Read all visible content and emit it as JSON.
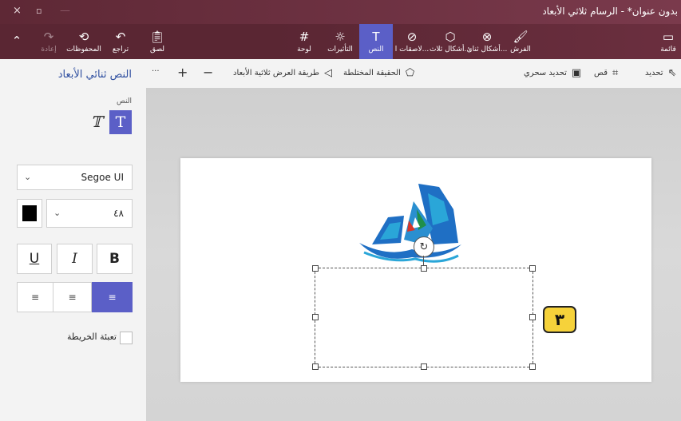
{
  "titlebar": {
    "title": "بدون عنوان* - الرسام ثلاثي الأبعاد",
    "close_glyph": "×",
    "restore_glyph": "▫",
    "minimize_glyph": "—"
  },
  "ribbon": {
    "menu": {
      "label": "قائمة",
      "icon": "menu-icon"
    },
    "brushes": {
      "label": "الفرش",
      "icon": "brush-icon"
    },
    "shapes2d": {
      "label": "أشكال ثنائ...",
      "icon": "2d-shapes-icon"
    },
    "shapes3d": {
      "label": "أشكال ثلاث...",
      "icon": "3d-shapes-icon"
    },
    "stickers": {
      "label": "لاصقات ا...",
      "icon": "sticker-icon"
    },
    "text": {
      "label": "النص",
      "icon": "text-icon"
    },
    "effects": {
      "label": "التأثيرات",
      "icon": "effects-icon"
    },
    "canvas": {
      "label": "لوحة",
      "icon": "canvas-icon"
    },
    "paste": {
      "label": "لصق",
      "icon": "paste-icon"
    },
    "undo": {
      "label": "تراجع",
      "icon": "undo-icon"
    },
    "history": {
      "label": "المحفوظات",
      "icon": "history-icon"
    },
    "redo": {
      "label": "إعادة",
      "icon": "redo-icon"
    },
    "collapse": {
      "icon": "chevron-up-icon"
    }
  },
  "toolbar": {
    "select": "تحديد",
    "crop": "قص",
    "magic_select": "تحديد سحري",
    "mixed_reality": "الحقيقة المختلطة",
    "view3d": "طريقة العرض ثلاثية الأبعاد",
    "zoom_out": "−",
    "zoom_in": "+",
    "more": "···"
  },
  "panel": {
    "title": "النص ثنائي الأبعاد",
    "text_section_label": "النص",
    "font_family": "Segoe UI",
    "font_size": "٤٨",
    "text_color": "#000000",
    "underline": "U",
    "italic": "I",
    "bold": "B",
    "fill_background_label": "تعبئة الخريطة"
  },
  "canvas": {
    "badge_text": "٣"
  },
  "colors": {
    "accent": "#5b5fc7",
    "titlebar": "#5e2835",
    "badge": "#f6d23a",
    "logo_blue": "#1f6fc4",
    "logo_cyan": "#2aa6d8",
    "logo_green": "#1f8f4a",
    "logo_red": "#d8352a"
  }
}
